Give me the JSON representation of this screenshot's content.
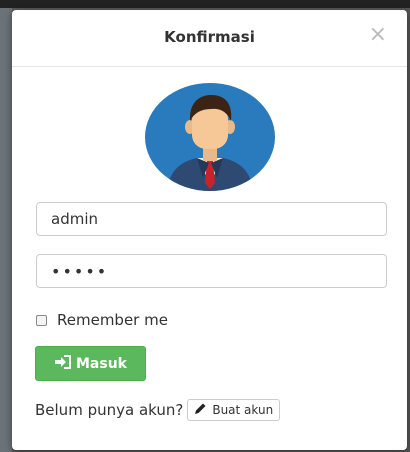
{
  "modal": {
    "title": "Konfirmasi",
    "close_symbol": "×"
  },
  "form": {
    "username_value": "admin",
    "password_value": "•••••",
    "remember_label": "Remember me",
    "remember_checked": false,
    "submit_label": "Masuk",
    "submit_icon": "sign-in-icon"
  },
  "register": {
    "prompt": "Belum punya akun?",
    "button_label": "Buat akun",
    "button_icon": "pencil-icon"
  },
  "avatar": {
    "icon": "user-avatar-icon"
  },
  "colors": {
    "submit_bg": "#5cb85c",
    "avatar_bg": "#2a7bbd"
  }
}
